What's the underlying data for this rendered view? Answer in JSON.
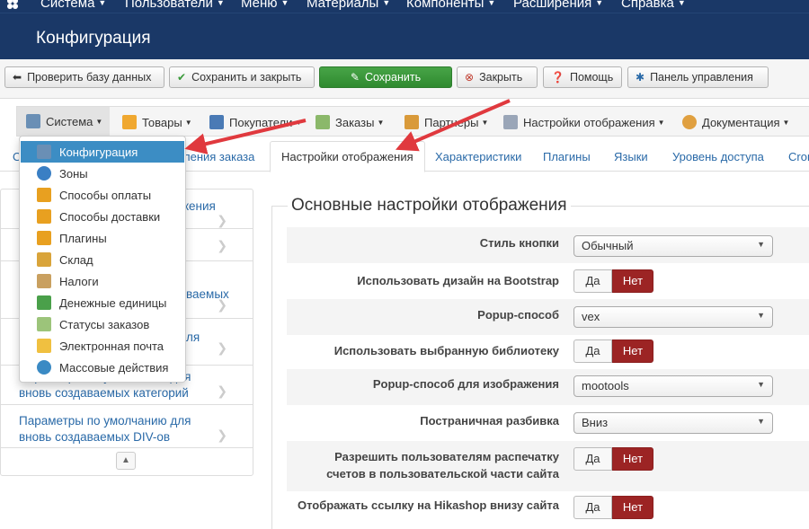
{
  "topnav": {
    "items": [
      "Система",
      "Пользователи",
      "Меню",
      "Материалы",
      "Компоненты",
      "Расширения",
      "Справка"
    ]
  },
  "page": {
    "title": "Конфигурация"
  },
  "toolbar": {
    "check_db": "Проверить базу данных",
    "save_close": "Сохранить и закрыть",
    "save": "Сохранить",
    "close": "Закрыть",
    "help": "Помощь",
    "control_panel": "Панель управления"
  },
  "submenu": {
    "items": [
      "Система",
      "Товары",
      "Покупатели",
      "Заказы",
      "Партнеры",
      "Настройки отображения",
      "Документация"
    ]
  },
  "tabs": {
    "items": [
      "О",
      "ления заказа",
      "Настройки отображения",
      "Характеристики",
      "Плагины",
      "Языки",
      "Уровень доступа",
      "Cron"
    ]
  },
  "dropdown": {
    "items": [
      "Конфигурация",
      "Зоны",
      "Способы оплаты",
      "Способы доставки",
      "Плагины",
      "Склад",
      "Налоги",
      "Денежные единицы",
      "Статусы заказов",
      "Электронная почта",
      "Массовые действия"
    ]
  },
  "left_panel": {
    "items": [
      [
        "жения"
      ],
      [
        ""
      ],
      [
        "ваемых"
      ],
      [
        "ля"
      ],
      [
        "Параметры по умолчанию для",
        "вновь создаваемых категорий"
      ],
      [
        "Параметры по умолчанию для",
        "вновь создаваемых DIV-ов"
      ]
    ]
  },
  "form": {
    "section_title": "Основные настройки отображения",
    "rows": [
      {
        "label": "Стиль кнопки",
        "type": "select",
        "value": "Обычный"
      },
      {
        "label": "Использовать дизайн на Bootstrap",
        "type": "toggle",
        "value": "Нет"
      },
      {
        "label": "Popup-способ",
        "type": "select",
        "value": "vex"
      },
      {
        "label": "Использовать выбранную библиотеку",
        "type": "toggle",
        "value": "Нет"
      },
      {
        "label": "Popup-способ для изображения",
        "type": "select",
        "value": "mootools"
      },
      {
        "label": "Постраничная разбивка",
        "type": "select",
        "value": "Вниз"
      },
      {
        "label": "Разрешить пользователям распечатку",
        "label2": "счетов в пользовательской части сайта",
        "type": "toggle",
        "value": "Нет"
      },
      {
        "label": "Отображать ссылку на Hikashop внизу сайта",
        "type": "toggle",
        "value": "Нет"
      }
    ],
    "yes": "Да",
    "no": "Нет"
  },
  "colors": {
    "header": "#1a3867",
    "save_green": "#3a9a3a",
    "no_red": "#9c2424",
    "link": "#2a6aa8",
    "arrow": "#e0393e"
  }
}
